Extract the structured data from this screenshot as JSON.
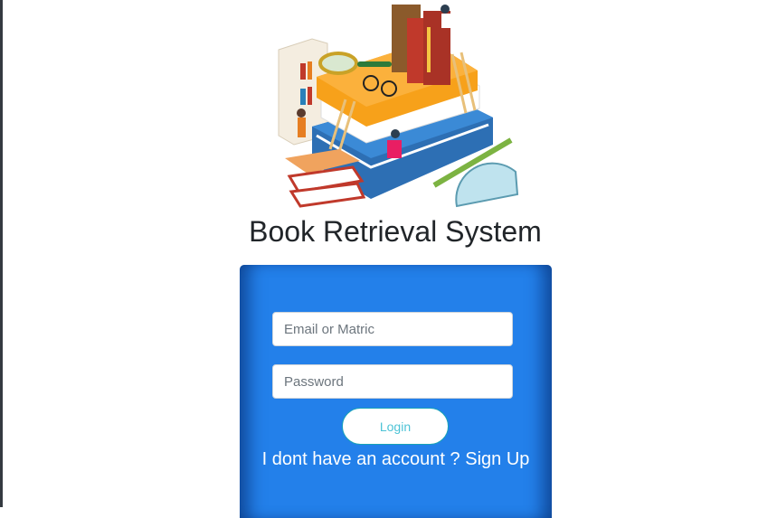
{
  "app": {
    "title": "Book Retrieval System"
  },
  "hero": {
    "image": "books-stack-illustration"
  },
  "form": {
    "email_placeholder": "Email or Matric",
    "password_placeholder": "Password",
    "login_label": "Login",
    "no_account_text": "I dont have an account ?",
    "signup_link": "Sign Up"
  },
  "colors": {
    "card": "#2380ea",
    "login_text": "#4dc3d6",
    "title": "#212529"
  }
}
